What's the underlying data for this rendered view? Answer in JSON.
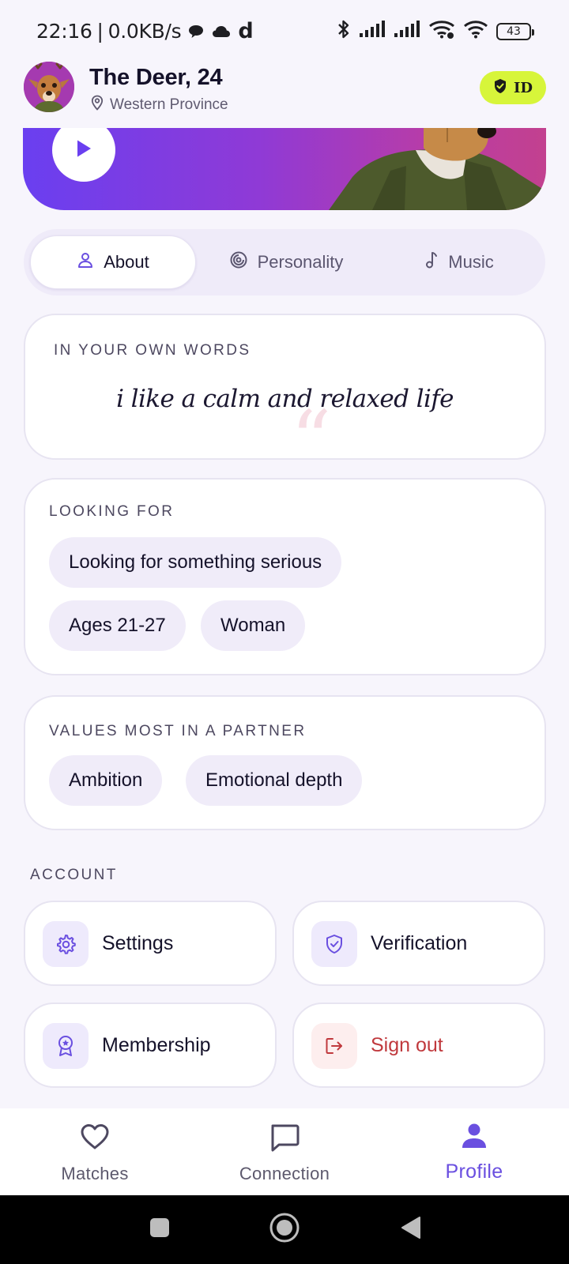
{
  "status_bar": {
    "time": "22:16",
    "separator": "|",
    "speed": "0.0KB/s",
    "d_icon": "d",
    "battery": "43"
  },
  "profile": {
    "name": "The Deer, 24",
    "location": "Western Province",
    "badge": "ID"
  },
  "tabs": [
    {
      "label": "About",
      "icon": "person-icon",
      "active": true
    },
    {
      "label": "Personality",
      "icon": "personality-icon",
      "active": false
    },
    {
      "label": "Music",
      "icon": "music-note-icon",
      "active": false
    }
  ],
  "quote_card": {
    "label": "IN YOUR OWN WORDS",
    "text": "i like a calm and relaxed life",
    "marks": "“"
  },
  "looking_for": {
    "label": "LOOKING FOR",
    "chips": [
      "Looking for something serious",
      "Ages 21-27",
      "Woman"
    ]
  },
  "values": {
    "label": "VALUES MOST IN A PARTNER",
    "chips": [
      "Ambition",
      "Emotional depth"
    ]
  },
  "account": {
    "title": "ACCOUNT",
    "items": [
      {
        "label": "Settings",
        "icon": "gear-icon"
      },
      {
        "label": "Verification",
        "icon": "shield-check-icon"
      },
      {
        "label": "Membership",
        "icon": "award-icon"
      },
      {
        "label": "Sign out",
        "icon": "sign-out-icon"
      }
    ]
  },
  "bottom_nav": [
    {
      "label": "Matches",
      "icon": "heart-icon",
      "active": false
    },
    {
      "label": "Connection",
      "icon": "chat-bubble-icon",
      "active": false
    },
    {
      "label": "Profile",
      "icon": "person-icon",
      "active": true
    }
  ],
  "colors": {
    "accent": "#6a4fe0",
    "badge": "#d7f53a",
    "danger": "#c0393d",
    "background": "#f7f5fc",
    "chip": "#f0ecf9"
  }
}
